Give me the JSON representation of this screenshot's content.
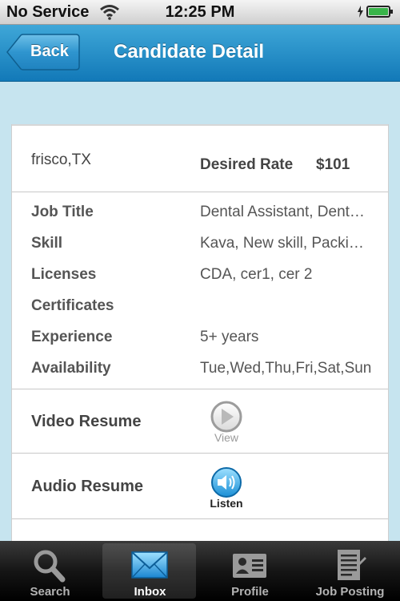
{
  "status_bar": {
    "carrier": "No Service",
    "time": "12:25 PM",
    "battery_color": "#39b54a"
  },
  "nav": {
    "back_label": "Back",
    "title": "Candidate Detail",
    "bar_color": "#1f8cc7"
  },
  "candidate": {
    "location": "frisco,TX",
    "desired_rate_label": "Desired Rate",
    "desired_rate_value": "$101",
    "details": [
      {
        "label": "Job Title",
        "value": "Dental Assistant, Dent…"
      },
      {
        "label": "Skill",
        "value": "Kava, New skill, Packi…"
      },
      {
        "label": "Licenses",
        "value": "CDA, cer1, cer 2"
      },
      {
        "label": "Certificates",
        "value": ""
      },
      {
        "label": "Experience",
        "value": "5+ years"
      },
      {
        "label": "Availability",
        "value": "Tue,Wed,Thu,Fri,Sat,Sun"
      }
    ],
    "video_resume": {
      "label": "Video Resume",
      "button": "View",
      "icon": "play-icon"
    },
    "audio_resume": {
      "label": "Audio Resume",
      "button": "Listen",
      "icon": "speaker-icon"
    }
  },
  "tabs": [
    {
      "label": "Search",
      "icon": "search-icon",
      "selected": false
    },
    {
      "label": "Inbox",
      "icon": "envelope-icon",
      "selected": true
    },
    {
      "label": "Profile",
      "icon": "profile-card-icon",
      "selected": false
    },
    {
      "label": "Job Posting",
      "icon": "document-icon",
      "selected": false
    }
  ]
}
